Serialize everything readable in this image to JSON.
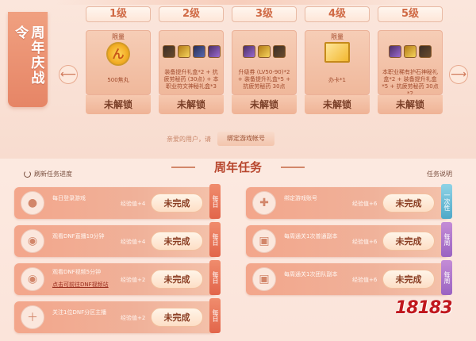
{
  "banner": {
    "title": "周年庆战令"
  },
  "levels": [
    {
      "tab": "1级",
      "badge": "限量",
      "icon": "coin-icon",
      "desc": "500焦丸",
      "status": "未解锁"
    },
    {
      "tab": "2级",
      "badge": "",
      "icon": "items-icon",
      "desc": "装备提升礼盒*2 + 抗疲劳秘药 (30点) + 本职业符文神秘礼盒*3",
      "status": "未解锁"
    },
    {
      "tab": "3级",
      "badge": "",
      "icon": "items-icon",
      "desc": "升级券 (LV50-90)*2 + 装备提升礼盒*5 + 抗疲劳秘药 30点",
      "status": "未解锁"
    },
    {
      "tab": "4级",
      "badge": "限量",
      "icon": "ticket-icon",
      "desc": "办卡*1",
      "status": "未解锁"
    },
    {
      "tab": "5级",
      "badge": "",
      "icon": "items-icon",
      "desc": "本职业稀有护石神秘礼盒*2 + 装备提升礼盒*5 + 抗疲劳秘药 30点*2",
      "status": "未解锁"
    }
  ],
  "bind": {
    "text": "亲爱的用户，请",
    "button": "绑定游戏帐号"
  },
  "section_title": "周年任务",
  "refresh": "刷新任务进度",
  "task_info": "任务说明",
  "tasks": [
    {
      "name": "每日登录游戏",
      "link": "",
      "exp": "经验值+4",
      "button": "未完成",
      "tag": "每日",
      "icon": "user-icon"
    },
    {
      "name": "绑定游戏账号",
      "link": "",
      "exp": "经验值+6",
      "button": "未完成",
      "tag": "一次性",
      "icon": "bandage-icon"
    },
    {
      "name": "观看DNF直播10分钟",
      "link": "",
      "exp": "经验值+4",
      "button": "未完成",
      "tag": "每日",
      "icon": "eye-icon"
    },
    {
      "name": "每周通关1次普通副本",
      "link": "",
      "exp": "经验值+6",
      "button": "未完成",
      "tag": "每周",
      "icon": "image-icon"
    },
    {
      "name": "观看DNF视频5分钟",
      "link": "点击可前往DNF视频站",
      "exp": "经验值+2",
      "button": "未完成",
      "tag": "每日",
      "icon": "eye-icon"
    },
    {
      "name": "每周通关1次团队副本",
      "link": "",
      "exp": "经验值+6",
      "button": "未完成",
      "tag": "每周",
      "icon": "image-icon"
    },
    {
      "name": "关注1位DNF分区主播",
      "link": "",
      "exp": "经验值+2",
      "button": "未完成",
      "tag": "每日",
      "icon": "user-add-icon"
    }
  ],
  "watermark": {
    "text": "18183",
    "sub": ""
  }
}
